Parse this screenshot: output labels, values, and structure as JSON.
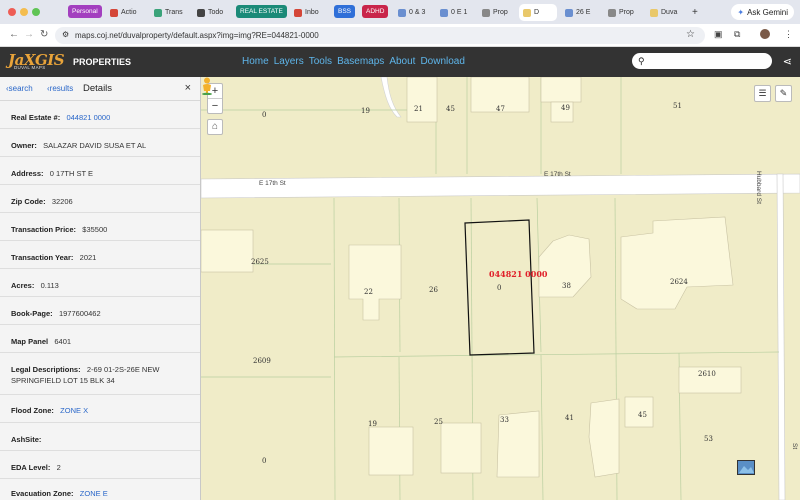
{
  "browser": {
    "tabs": [
      {
        "label": "Personal",
        "kind": "pill",
        "color": "#a33fbf"
      },
      {
        "label": "Actio",
        "icon": "gmail-icon"
      },
      {
        "label": "Trans",
        "icon": "trello-icon"
      },
      {
        "label": "Todo",
        "icon": "todo-icon"
      },
      {
        "label": "REAL ESTATE",
        "kind": "pill",
        "color": "#1b8a78"
      },
      {
        "label": "Inbo",
        "icon": "gmail-icon"
      },
      {
        "label": "BSS",
        "kind": "pill",
        "color": "#2f6fd8"
      },
      {
        "label": "ADHD",
        "kind": "pill",
        "color": "#c9254a"
      },
      {
        "label": "0 & 3",
        "icon": "globe-icon"
      },
      {
        "label": "0 E 1",
        "icon": "globe-icon"
      },
      {
        "label": "Prop",
        "icon": "globe-icon"
      },
      {
        "label": "D",
        "icon": "page-icon",
        "active": true
      },
      {
        "label": "26 E",
        "icon": "globe-icon"
      },
      {
        "label": "Prop",
        "icon": "globe-icon"
      },
      {
        "label": "Duva",
        "icon": "page-icon"
      }
    ],
    "new_tab": "+",
    "ask_gemini": "Ask Gemini",
    "url": "maps.coj.net/duvalproperty/default.aspx?img=img?RE=044821-0000"
  },
  "app": {
    "logo_main": "JaXGIS",
    "logo_sub": "DUVAL MAPS",
    "title": "PROPERTIES",
    "nav": [
      "Home",
      "Layers",
      "Tools",
      "Basemaps",
      "About",
      "Download"
    ],
    "search_placeholder": ""
  },
  "panel": {
    "back_search": "search",
    "back_results": "results",
    "heading": "Details",
    "close": "×",
    "fields": [
      {
        "label": "Real Estate #:",
        "value": "044821 0000",
        "link": true
      },
      {
        "label": "Owner:",
        "value": "SALAZAR DAVID SUSA ET AL"
      },
      {
        "label": "Address:",
        "value": "0 17TH ST E"
      },
      {
        "label": "Zip Code:",
        "value": "32206"
      },
      {
        "label": "Transaction Price:",
        "value": "$35500"
      },
      {
        "label": "Transaction Year:",
        "value": "2021"
      },
      {
        "label": "Acres:",
        "value": "0.113"
      },
      {
        "label": "Book-Page:",
        "value": "1977600462"
      },
      {
        "label": "Map Panel",
        "value": "6401"
      },
      {
        "label": "Legal Descriptions:",
        "value": "2-69 01-2S-26E NEW SPRINGFIELD LOT 15 BLK 34"
      },
      {
        "label": "Flood Zone:",
        "value": "ZONE X",
        "link": true
      },
      {
        "label": "AshSite:",
        "value": ""
      },
      {
        "label": "EDA Level:",
        "value": "2"
      },
      {
        "label": "Evacuation Zone:",
        "value": "ZONE E",
        "link": true
      }
    ]
  },
  "map": {
    "streets": [
      "E 17th St",
      "E 17th St",
      "Hubbard St",
      "Hubbard St"
    ],
    "lot_numbers": [
      "0",
      "19",
      "21",
      "45",
      "47",
      "49",
      "51",
      "2625",
      "22",
      "26",
      "0",
      "38",
      "2624",
      "2609",
      "2610",
      "19",
      "25",
      "33",
      "41",
      "45",
      "53",
      "0"
    ],
    "selected_parcel": "044821 0000",
    "zoom_in": "+",
    "zoom_out": "−"
  }
}
